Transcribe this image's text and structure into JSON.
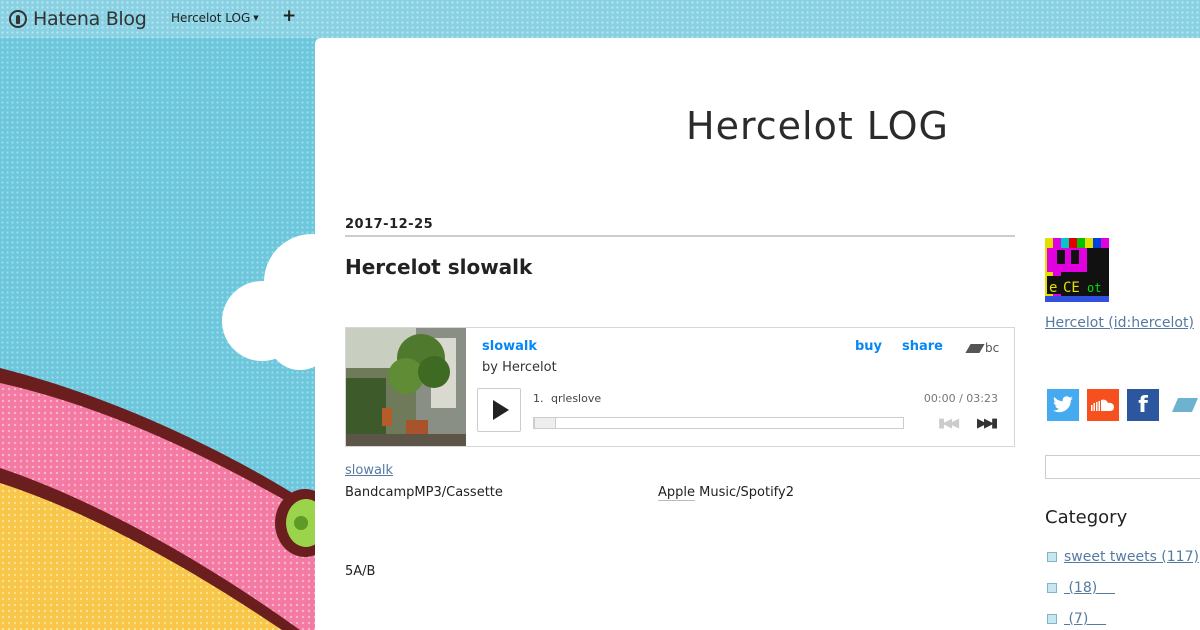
{
  "topbar": {
    "logo_text": "Hatena Blog",
    "blog_name": "Hercelot LOG",
    "add_symbol": "+"
  },
  "blog": {
    "title": "Hercelot LOG"
  },
  "entry": {
    "date": "2017-12-25",
    "title": "Hercelot slowalk",
    "player": {
      "album": "slowalk",
      "artist": "by Hercelot",
      "buy_label": "buy",
      "share_label": "share",
      "brand": "bc",
      "track_number": "1.",
      "track_name": "qrleslove",
      "time": "00:00 / 03:23",
      "progress": 0
    },
    "album_link": "slowalk",
    "line_left": "BandcampMP3/Cassette",
    "line_right_prefix": "Apple",
    "line_right_suffix": " Music/Spotify2",
    "line_3": "5A/B"
  },
  "sidebar": {
    "author_link": "Hercelot (id:hercelot)",
    "social_icons": [
      "twitter-icon",
      "soundcloud-icon",
      "facebook-icon",
      "hatena-bookmark-icon"
    ],
    "facebook_glyph": "f",
    "category_heading": "Category",
    "categories": [
      {
        "label": "sweet tweets (117)"
      },
      {
        "label": " (18)    "
      },
      {
        "label": " (7)    "
      }
    ]
  },
  "colors": {
    "sky": "#6cc7dd",
    "link": "#557aa0",
    "bandcamp_blue": "#0687f5",
    "twitter": "#46aaf0",
    "soundcloud": "#f5501e",
    "facebook": "#2c579e"
  }
}
